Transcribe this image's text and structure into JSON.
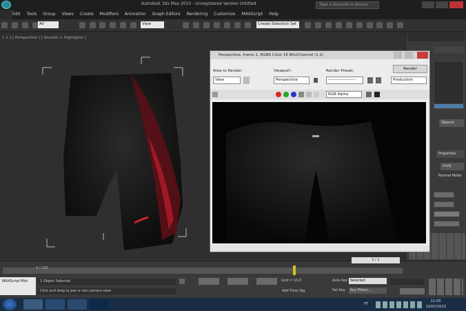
{
  "titlebar": {
    "app_title": "Autodesk 3ds Max 2010 - Unregistered Version   Untitled",
    "search_placeholder": "Type a keyword or phrase"
  },
  "menubar": {
    "items": [
      "Edit",
      "Tools",
      "Group",
      "Views",
      "Create",
      "Modifiers",
      "Animation",
      "Graph Editors",
      "Rendering",
      "Customize",
      "MAXScript",
      "Help"
    ]
  },
  "toolbar": {
    "selection_filter": "All",
    "reference_coord": "View",
    "named_selection": "Create Selection Set"
  },
  "viewport": {
    "label": "[ + ] [ Perspective ] [ Smooth + Highlights ]"
  },
  "render_window": {
    "title": "Perspective, frame 1, RGBA Color 16 Bits/Channel (1:1)",
    "area_label": "Area to Render:",
    "area_value": "View",
    "viewport_label": "Viewport:",
    "viewport_value": "Perspective",
    "preset_label": "Render Preset:",
    "preset_value": "--------------------",
    "render_button": "Render",
    "mode_value": "Production",
    "channel_value": "RGB Alpha"
  },
  "command_panel": {
    "items": [
      "Objects",
      "Properties",
      "Unify",
      "Normal Mode"
    ]
  },
  "timeline": {
    "frame": "0 / 100",
    "counter": "1 / 1"
  },
  "statusbar": {
    "maxscript": "MAXScript Mini",
    "selection": "1 Object Selected",
    "prompt": "Click and drag to pan a non-camera view",
    "grid": "Grid = 10,0",
    "autokey": "Auto Key",
    "selected": "Selected",
    "setkey": "Set Key",
    "keyfilters": "Key Filters...",
    "addtimetag": "Add Time Tag"
  },
  "taskbar": {
    "lang": "PT",
    "time": "11:50",
    "date": "22/07/2013"
  }
}
